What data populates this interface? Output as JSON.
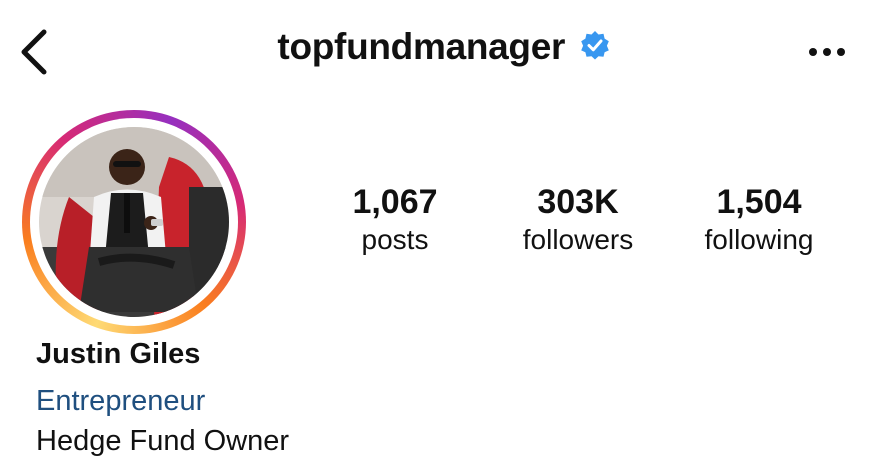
{
  "header": {
    "username": "topfundmanager",
    "verified": true,
    "icons": {
      "back": "chevron-left-icon",
      "verified": "verified-badge-icon",
      "more": "more-horizontal-icon"
    },
    "colors": {
      "verified_badge": "#3897f0"
    }
  },
  "profile": {
    "avatar": "profile-photo",
    "ring_colors": [
      "#feda75",
      "#fa7e1e",
      "#d62976",
      "#962fbf"
    ]
  },
  "stats": [
    {
      "value": "1,067",
      "label": "posts"
    },
    {
      "value": "303K",
      "label": "followers"
    },
    {
      "value": "1,504",
      "label": "following"
    }
  ],
  "bio": {
    "name": "Justin Giles",
    "category": "Entrepreneur",
    "text": "Hedge Fund Owner",
    "colors": {
      "category": "#1f4f7f"
    }
  }
}
